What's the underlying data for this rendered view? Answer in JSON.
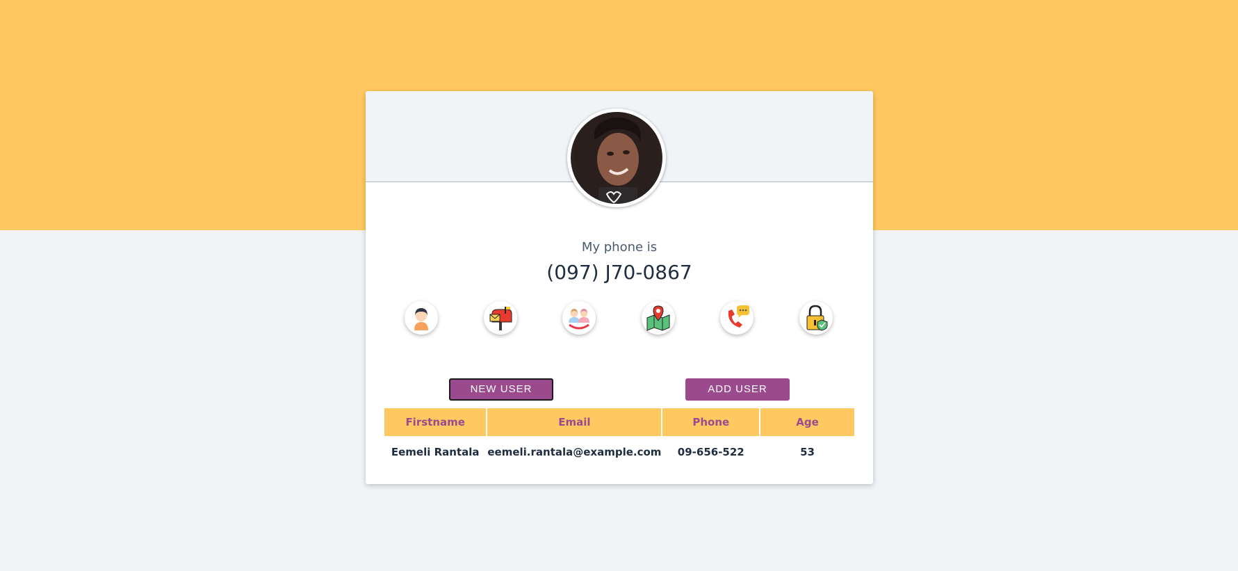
{
  "profile": {
    "label": "My phone is",
    "value": "(097) J70-0867"
  },
  "icons": [
    {
      "name": "user-icon"
    },
    {
      "name": "mailbox-icon"
    },
    {
      "name": "birthday-icon"
    },
    {
      "name": "map-icon"
    },
    {
      "name": "phone-icon"
    },
    {
      "name": "lock-icon"
    }
  ],
  "buttons": {
    "new_user": "NEW USER",
    "add_user": "ADD USER"
  },
  "table": {
    "headers": [
      "Firstname",
      "Email",
      "Phone",
      "Age"
    ],
    "rows": [
      [
        "Eemeli Rantala",
        "eemeli.rantala@example.com",
        "09-656-522",
        "53"
      ]
    ]
  },
  "colors": {
    "accent": "#9b4a8e",
    "brand_yellow": "#ffc860",
    "background": "#f0f4f7"
  }
}
